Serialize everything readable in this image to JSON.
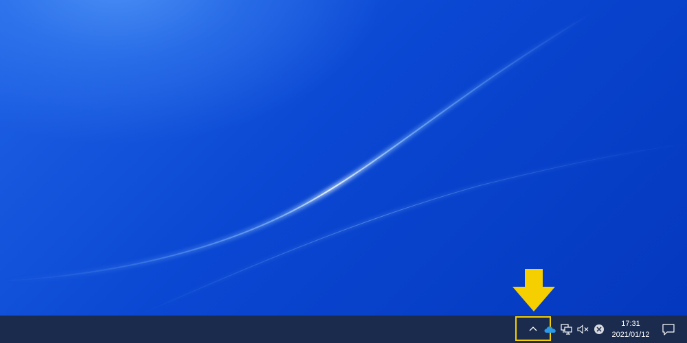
{
  "taskbar": {
    "clock": {
      "time": "17:31",
      "date": "2021/01/12"
    },
    "tray": {
      "chevron_icon": "chevron-up-icon",
      "icons": [
        "onedrive-icon",
        "network-icon",
        "volume-muted-icon",
        "close-circle-icon"
      ]
    },
    "notification_icon": "action-center-icon"
  },
  "annotation": {
    "arrow_color": "#f5cf00",
    "highlight_color": "#f5cf00"
  },
  "colors": {
    "taskbar_bg": "#1a2b4e",
    "wallpaper_blue": "#0a47d2",
    "onedrive_blue": "#2b9ae8"
  }
}
